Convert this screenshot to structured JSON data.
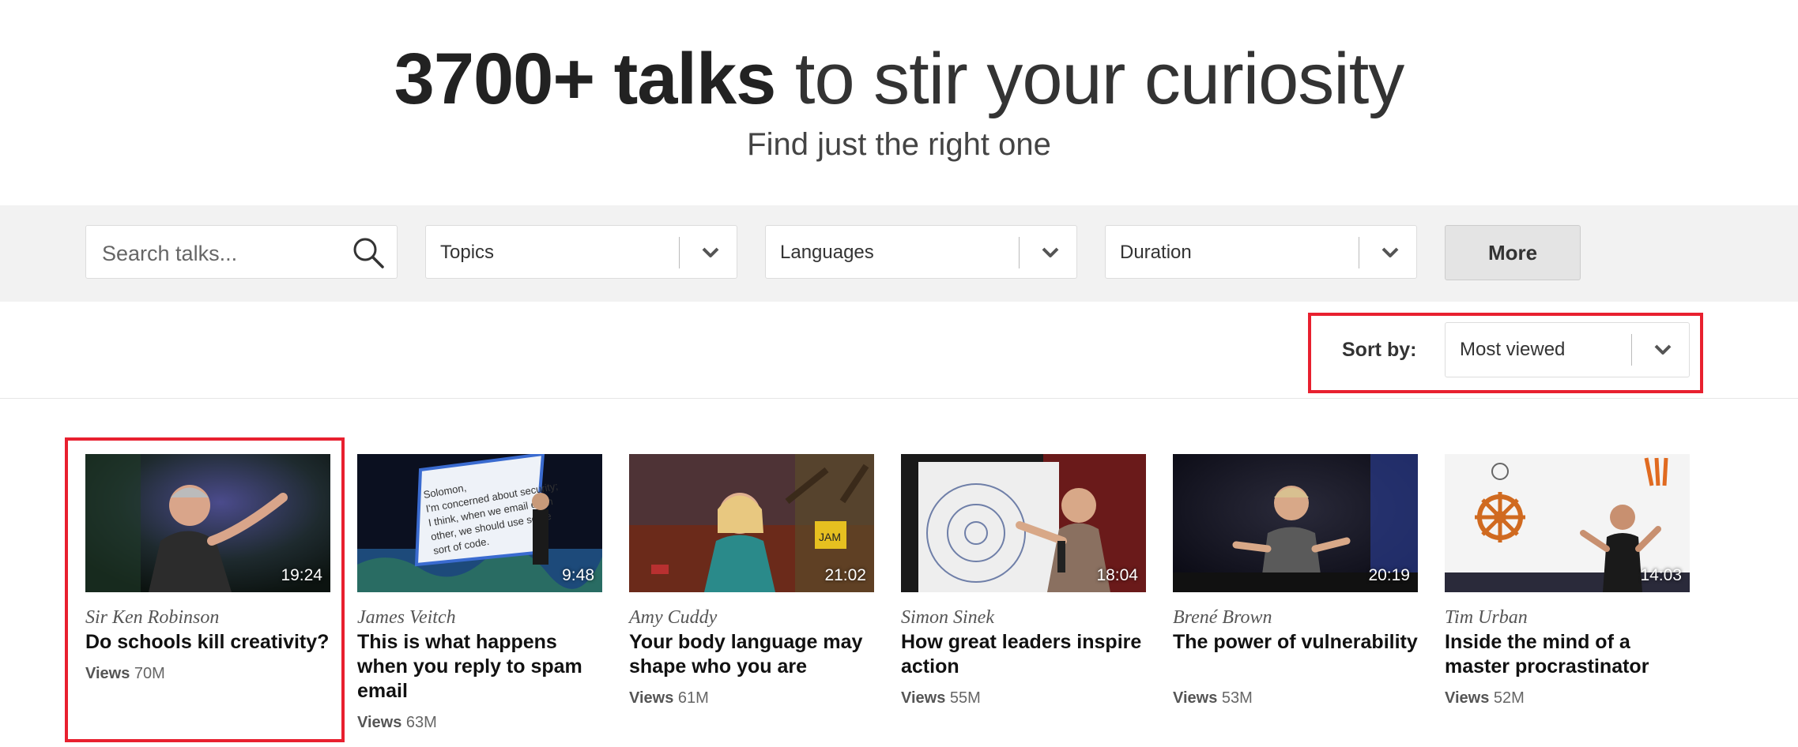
{
  "hero": {
    "title_bold": "3700+ talks",
    "title_light": " to stir your curiosity",
    "subtitle": "Find just the right one"
  },
  "filters": {
    "search_placeholder": "Search talks...",
    "topics_label": "Topics",
    "languages_label": "Languages",
    "duration_label": "Duration",
    "more_label": "More"
  },
  "sort": {
    "label": "Sort by:",
    "selected": "Most viewed"
  },
  "views_label": "Views",
  "talks": [
    {
      "speaker": "Sir Ken Robinson",
      "title": "Do schools kill creativity?",
      "views": "70M",
      "duration": "19:24"
    },
    {
      "speaker": "James Veitch",
      "title": "This is what happens when you reply to spam email",
      "views": "63M",
      "duration": "9:48"
    },
    {
      "speaker": "Amy Cuddy",
      "title": "Your body language may shape who you are",
      "views": "61M",
      "duration": "21:02"
    },
    {
      "speaker": "Simon Sinek",
      "title": "How great leaders inspire action",
      "views": "55M",
      "duration": "18:04"
    },
    {
      "speaker": "Brené Brown",
      "title": "The power of vulnerability",
      "views": "53M",
      "duration": "20:19"
    },
    {
      "speaker": "Tim Urban",
      "title": "Inside the mind of a master procrastinator",
      "views": "52M",
      "duration": "14:03"
    }
  ],
  "thumbnail_slide_text": [
    "Solomon,",
    "I'm concerned about security;",
    "I think, when we email each",
    "other, we should use some",
    "sort of code."
  ],
  "thumbnail_jersey_text": "JAM",
  "colors": {
    "highlight": "#e8202f",
    "filter_bar_bg": "#f2f2f2"
  }
}
